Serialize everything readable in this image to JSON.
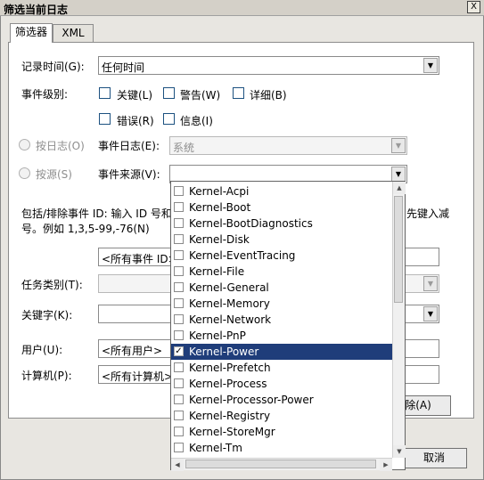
{
  "window": {
    "title": "筛选当前日志",
    "close_label": "X"
  },
  "tabs": [
    {
      "label": "筛选器"
    },
    {
      "label": "XML"
    }
  ],
  "form": {
    "logged_label": "记录时间(G):",
    "logged_value": "任何时间",
    "event_level_label": "事件级别:",
    "levels": {
      "critical": "关键(L)",
      "warning": "警告(W)",
      "verbose": "详细(B)",
      "error": "错误(R)",
      "info": "信息(I)"
    },
    "by_log_label": "按日志(O)",
    "event_logs_label": "事件日志(E):",
    "event_logs_value": "系统",
    "by_source_label": "按源(S)",
    "event_sources_label": "事件来源(V):",
    "event_sources_value": "",
    "event_id_desc_line1": "包括/排除事件 ID: 输入 ID 号和",
    "event_id_desc_line1_right": "先键入减",
    "event_id_desc_line2": "号。例如 1,3,5-99,-76(N)",
    "event_id_value": "<所有事件 ID>",
    "task_category_label": "任务类别(T):",
    "keywords_label": "关键字(K):",
    "user_label": "用户(U):",
    "user_value": "<所有用户>",
    "computer_label": "计算机(P):",
    "computer_value": "<所有计算机>",
    "clear_label": "清除(A)",
    "cancel_label": "取消"
  },
  "dropdown_items": [
    {
      "label": "Kernel-Acpi",
      "checked": false,
      "selected": false
    },
    {
      "label": "Kernel-Boot",
      "checked": false,
      "selected": false
    },
    {
      "label": "Kernel-BootDiagnostics",
      "checked": false,
      "selected": false
    },
    {
      "label": "Kernel-Disk",
      "checked": false,
      "selected": false
    },
    {
      "label": "Kernel-EventTracing",
      "checked": false,
      "selected": false
    },
    {
      "label": "Kernel-File",
      "checked": false,
      "selected": false
    },
    {
      "label": "Kernel-General",
      "checked": false,
      "selected": false
    },
    {
      "label": "Kernel-Memory",
      "checked": false,
      "selected": false
    },
    {
      "label": "Kernel-Network",
      "checked": false,
      "selected": false
    },
    {
      "label": "Kernel-PnP",
      "checked": false,
      "selected": false
    },
    {
      "label": "Kernel-Power",
      "checked": true,
      "selected": true
    },
    {
      "label": "Kernel-Prefetch",
      "checked": false,
      "selected": false
    },
    {
      "label": "Kernel-Process",
      "checked": false,
      "selected": false
    },
    {
      "label": "Kernel-Processor-Power",
      "checked": false,
      "selected": false
    },
    {
      "label": "Kernel-Registry",
      "checked": false,
      "selected": false
    },
    {
      "label": "Kernel-StoreMgr",
      "checked": false,
      "selected": false
    },
    {
      "label": "Kernel-Tm",
      "checked": false,
      "selected": false
    }
  ]
}
